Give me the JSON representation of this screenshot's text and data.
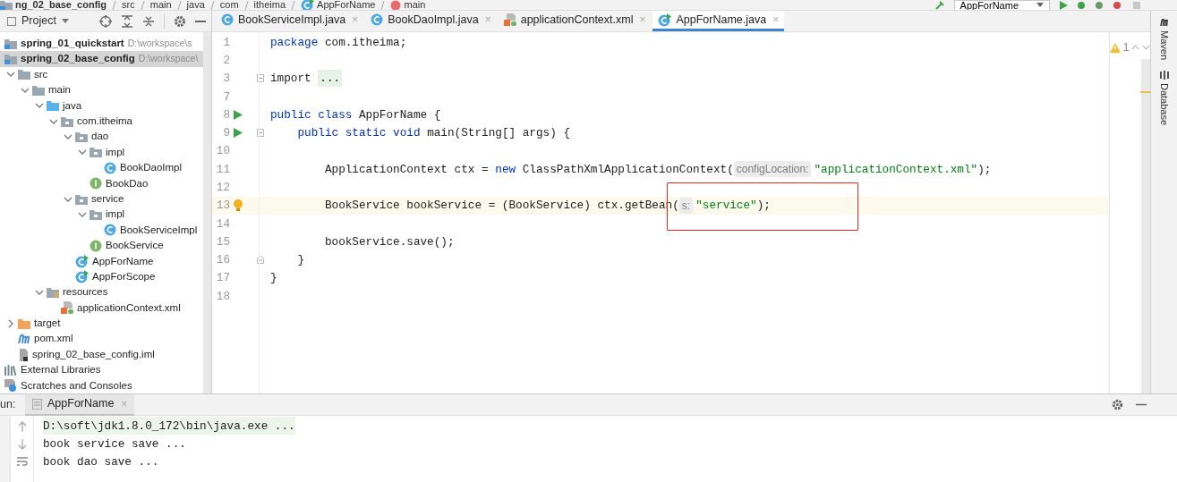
{
  "breadcrumb": [
    {
      "label": "ng_02_base_config",
      "kind": "module"
    },
    {
      "label": "src",
      "kind": "plain"
    },
    {
      "label": "main",
      "kind": "plain"
    },
    {
      "label": "java",
      "kind": "plain"
    },
    {
      "label": "com",
      "kind": "plain"
    },
    {
      "label": "itheima",
      "kind": "plain"
    },
    {
      "label": "AppForName",
      "kind": "class"
    },
    {
      "label": "main",
      "kind": "method"
    }
  ],
  "run_config": {
    "label": "AppForName"
  },
  "project_panel": {
    "title": "Project",
    "tree": [
      {
        "label": "spring_01_quickstart",
        "path": "D:\\workspace\\s",
        "kind": "module",
        "selected": false
      },
      {
        "label": "spring_02_base_config",
        "path": "D:\\workspace\\",
        "kind": "module",
        "selected": true,
        "children": [
          {
            "label": "src",
            "kind": "folder",
            "selected": false,
            "expanded": true,
            "children": [
              {
                "label": "main",
                "kind": "folder",
                "selected": false,
                "expanded": true,
                "children": [
                  {
                    "label": "java",
                    "kind": "source",
                    "selected": false,
                    "expanded": true,
                    "children": [
                      {
                        "label": "com.itheima",
                        "kind": "package",
                        "selected": false,
                        "expanded": true,
                        "children": [
                          {
                            "label": "dao",
                            "kind": "package",
                            "selected": false,
                            "expanded": true,
                            "children": [
                              {
                                "label": "impl",
                                "kind": "package",
                                "selected": false,
                                "expanded": true,
                                "children": [
                                  {
                                    "label": "BookDaoImpl",
                                    "kind": "class",
                                    "selected": false
                                  }
                                ]
                              },
                              {
                                "label": "BookDao",
                                "kind": "interface",
                                "selected": false
                              }
                            ]
                          },
                          {
                            "label": "service",
                            "kind": "package",
                            "selected": false,
                            "expanded": true,
                            "children": [
                              {
                                "label": "impl",
                                "kind": "package",
                                "selected": false,
                                "expanded": true,
                                "children": [
                                  {
                                    "label": "BookServiceImpl",
                                    "kind": "class",
                                    "selected": false
                                  }
                                ]
                              },
                              {
                                "label": "BookService",
                                "kind": "interface",
                                "selected": false
                              }
                            ]
                          },
                          {
                            "label": "AppForName",
                            "kind": "runnable",
                            "selected": false
                          },
                          {
                            "label": "AppForScope",
                            "kind": "runnable",
                            "selected": false
                          }
                        ]
                      }
                    ]
                  },
                  {
                    "label": "resources",
                    "kind": "resources",
                    "selected": false,
                    "expanded": true,
                    "children": [
                      {
                        "label": "applicationContext.xml",
                        "kind": "xml",
                        "selected": false
                      }
                    ]
                  }
                ]
              }
            ]
          },
          {
            "label": "target",
            "kind": "excluded",
            "selected": false,
            "expanded": false
          },
          {
            "label": "pom.xml",
            "kind": "maven",
            "selected": false
          },
          {
            "label": "spring_02_base_config.iml",
            "kind": "iml",
            "selected": false
          }
        ]
      },
      {
        "label": "External Libraries",
        "kind": "libraries",
        "selected": false
      },
      {
        "label": "Scratches and Consoles",
        "kind": "scratches",
        "selected": false
      }
    ]
  },
  "tabs": [
    {
      "label": "BookServiceImpl.java",
      "kind": "class",
      "selected": false,
      "close": "×"
    },
    {
      "label": "BookDaoImpl.java",
      "kind": "class",
      "selected": false,
      "close": "×"
    },
    {
      "label": "applicationContext.xml",
      "kind": "xml",
      "selected": false,
      "close": "×"
    },
    {
      "label": "AppForName.java",
      "kind": "runnable",
      "selected": true,
      "close": "×"
    }
  ],
  "editor": {
    "warnings": "1",
    "lines": [
      {
        "number": "1",
        "current": false,
        "run": false,
        "bulb": false,
        "fold_start": false,
        "fold_end": false,
        "tokens": [
          {
            "kind": "keyword",
            "text": "package"
          },
          {
            "kind": "plain",
            "text": " com.itheima;"
          }
        ]
      },
      {
        "number": "2",
        "current": false,
        "run": false,
        "bulb": false,
        "fold_start": false,
        "fold_end": false
      },
      {
        "number": "3",
        "current": false,
        "run": false,
        "bulb": false,
        "fold_start": true,
        "fold_end": false,
        "tokens": [
          {
            "kind": "plain",
            "text": "import "
          },
          {
            "kind": "folded",
            "text": "..."
          }
        ]
      },
      {
        "number": "7",
        "current": false,
        "run": false,
        "bulb": false,
        "fold_start": false,
        "fold_end": false
      },
      {
        "number": "8",
        "current": false,
        "run": true,
        "bulb": false,
        "fold_start": false,
        "fold_end": false,
        "tokens": [
          {
            "kind": "keyword",
            "text": "public class"
          },
          {
            "kind": "plain",
            "text": " AppForName {"
          }
        ]
      },
      {
        "number": "9",
        "current": false,
        "run": true,
        "bulb": false,
        "fold_start": true,
        "fold_end": false,
        "tokens": [
          {
            "kind": "keyword",
            "text": "    public static void"
          },
          {
            "kind": "plain",
            "text": " main(String[] args) {"
          }
        ]
      },
      {
        "number": "10",
        "current": false,
        "run": false,
        "bulb": false,
        "fold_start": false,
        "fold_end": false
      },
      {
        "number": "11",
        "current": false,
        "run": false,
        "bulb": false,
        "fold_start": false,
        "fold_end": false,
        "tokens": [
          {
            "kind": "plain",
            "text": "        ApplicationContext ctx = "
          },
          {
            "kind": "keyword",
            "text": "new"
          },
          {
            "kind": "plain",
            "text": " ClassPathXmlApplicationContext("
          },
          {
            "kind": "hint",
            "text": "configLocation:"
          },
          {
            "kind": "string",
            "text": "\"applicationContext.xml\""
          },
          {
            "kind": "plain",
            "text": ");"
          }
        ]
      },
      {
        "number": "12",
        "current": false,
        "run": false,
        "bulb": false,
        "fold_start": false,
        "fold_end": false
      },
      {
        "number": "13",
        "current": true,
        "run": false,
        "bulb": true,
        "fold_start": false,
        "fold_end": false,
        "tokens": [
          {
            "kind": "plain",
            "text": "        BookService bookService = (BookService) ctx.getBean(",
            "boxed": false
          },
          {
            "kind": "hint",
            "text": "s:",
            "boxed": true
          },
          {
            "kind": "string",
            "text": "\"service\"",
            "boxed": true
          },
          {
            "kind": "plain",
            "text": ");",
            "boxed": true
          }
        ]
      },
      {
        "number": "14",
        "current": false,
        "run": false,
        "bulb": false,
        "fold_start": false,
        "fold_end": false
      },
      {
        "number": "15",
        "current": false,
        "run": false,
        "bulb": false,
        "fold_start": false,
        "fold_end": false,
        "tokens": [
          {
            "kind": "plain",
            "text": "        bookService.save();"
          }
        ]
      },
      {
        "number": "16",
        "current": false,
        "run": false,
        "bulb": false,
        "fold_start": false,
        "fold_end": true,
        "tokens": [
          {
            "kind": "plain",
            "text": "    }"
          }
        ]
      },
      {
        "number": "17",
        "current": false,
        "run": false,
        "bulb": false,
        "fold_start": false,
        "fold_end": false,
        "tokens": [
          {
            "kind": "plain",
            "text": "}"
          }
        ]
      },
      {
        "number": "18",
        "current": false,
        "run": false,
        "bulb": false,
        "fold_start": false,
        "fold_end": false
      }
    ]
  },
  "side_tools": [
    {
      "label": "Maven",
      "kind": "maven"
    },
    {
      "label": "Database",
      "kind": "database"
    }
  ],
  "run_panel": {
    "label": "un:",
    "tab": {
      "label": "AppForName",
      "close": "×"
    },
    "output": [
      {
        "kind": "command",
        "text": "D:\\soft\\jdk1.8.0_172\\bin\\java.exe ..."
      },
      {
        "kind": "plain",
        "text": "book service save ..."
      },
      {
        "kind": "plain",
        "text": "book dao save ..."
      }
    ]
  }
}
